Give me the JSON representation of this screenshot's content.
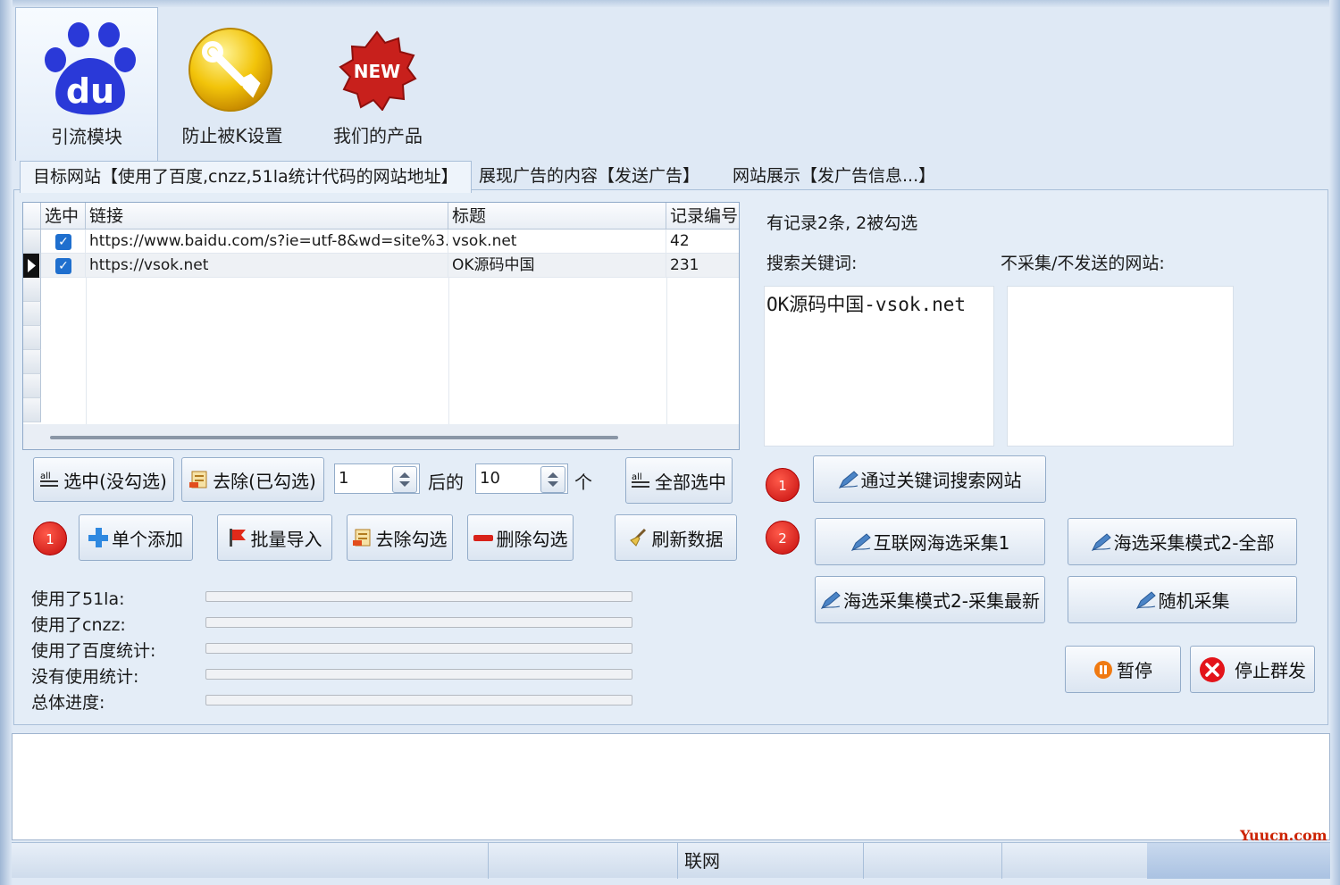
{
  "ribbon": {
    "items": [
      {
        "label": "引流模块",
        "icon": "baidu-paw-icon"
      },
      {
        "label": "防止被K设置",
        "icon": "wrench-icon"
      },
      {
        "label": "我们的产品",
        "icon": "new-badge-icon",
        "badge_text": "NEW"
      }
    ],
    "baidu_logo_text": "du"
  },
  "tabs": [
    "目标网站【使用了百度,cnzz,51la统计代码的网站地址】",
    "展现广告的内容【发送广告】",
    "网站展示【发广告信息...】"
  ],
  "grid": {
    "columns": [
      "选中",
      "链接",
      "标题",
      "记录编号"
    ],
    "rows": [
      {
        "checked": true,
        "link": "https://www.baidu.com/s?ie=utf-8&wd=site%3...",
        "title": "vsok.net",
        "id": "42"
      },
      {
        "checked": true,
        "link": "https://vsok.net",
        "title": "OK源码中国",
        "id": "231"
      }
    ]
  },
  "controls": {
    "select_unchecked": "选中(没勾选)",
    "remove_checked": "去除(已勾选)",
    "spin_start": "1",
    "after_label": "后的",
    "spin_count": "10",
    "unit_label": "个",
    "select_all": "全部选中"
  },
  "actions": {
    "badge1": "1",
    "add_single": "单个添加",
    "batch_import": "批量导入",
    "remove_tick": "去除勾选",
    "delete_tick": "删除勾选",
    "refresh": "刷新数据"
  },
  "progress": [
    {
      "label": "使用了51la:",
      "value": 0
    },
    {
      "label": "使用了cnzz:",
      "value": 0
    },
    {
      "label": "使用了百度统计:",
      "value": 0
    },
    {
      "label": "没有使用统计:",
      "value": 0
    },
    {
      "label": "总体进度:",
      "value": 0
    }
  ],
  "right": {
    "record_info": "有记录2条, 2被勾选",
    "keyword_label": "搜索关键词:",
    "exclude_label": "不采集/不发送的网站:",
    "keyword_value": "OK源码中国-vsok.net",
    "badge1": "1",
    "badge2": "2",
    "search_by_keyword": "通过关键词搜索网站",
    "internet_collect1": "互联网海选采集1",
    "mode2_all": "海选采集模式2-全部",
    "mode2_latest": "海选采集模式2-采集最新",
    "random_collect": "随机采集",
    "pause": "暂停",
    "stop_send": "停止群发"
  },
  "status": {
    "network": "联网"
  },
  "watermark": "Yuucn.com",
  "colors": {
    "accent_blue": "#1f6fce",
    "badge_red": "#d41515",
    "panel": "#e4edf7"
  }
}
